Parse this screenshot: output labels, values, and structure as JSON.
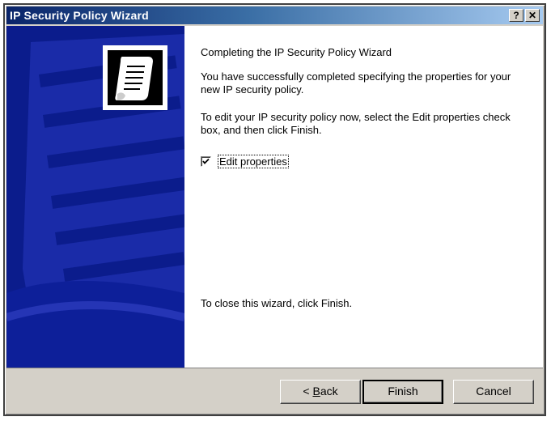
{
  "window": {
    "title": "IP Security Policy Wizard",
    "help_label": "?",
    "close_label": "✕"
  },
  "content": {
    "heading": "Completing the IP Security Policy Wizard",
    "paragraph1": "You have successfully completed specifying the properties for your new IP security policy.",
    "paragraph2": "To edit your IP security policy now, select the Edit properties check box, and then click Finish.",
    "checkbox": {
      "label": "Edit properties",
      "checked": true
    },
    "close_text": "To close this wizard, click Finish."
  },
  "buttons": {
    "back_prefix": "< ",
    "back_mnemonic": "B",
    "back_rest": "ack",
    "finish": "Finish",
    "cancel": "Cancel"
  },
  "colors": {
    "banner": "#0b1c8c",
    "title_gradient_start": "#0a246a",
    "face": "#d4d0c8"
  },
  "icons": {
    "banner_icon": "scroll-document-icon",
    "check": "checkmark-icon"
  }
}
